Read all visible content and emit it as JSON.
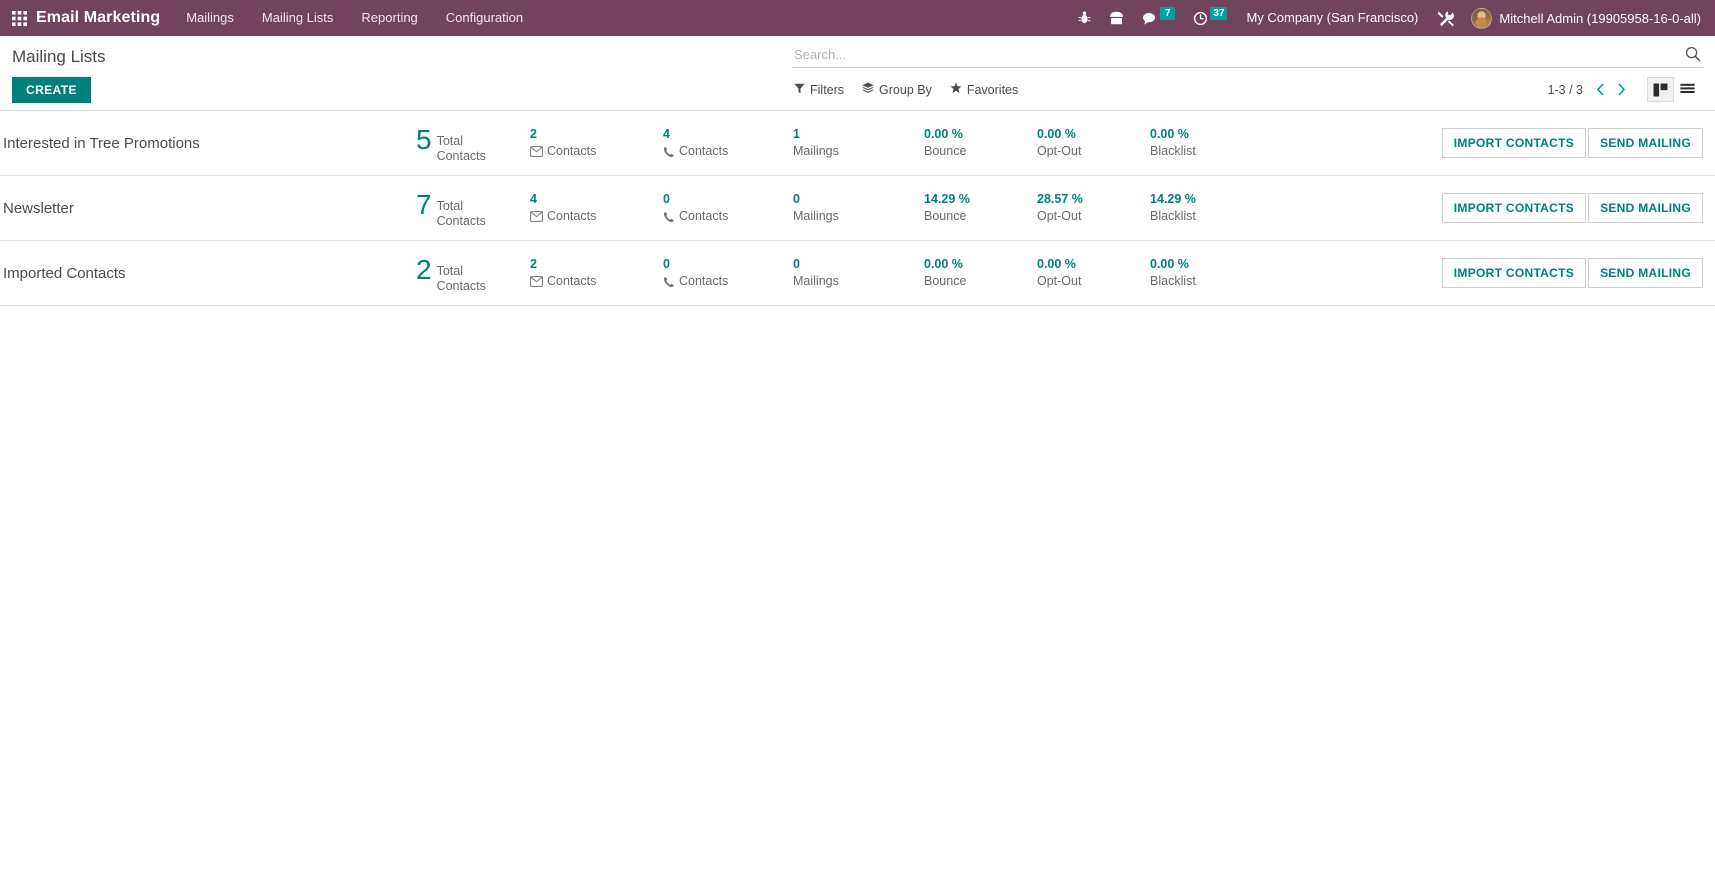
{
  "navbar": {
    "apps_icon": "apps-grid-icon",
    "brand": "Email Marketing",
    "menu": [
      {
        "label": "Mailings"
      },
      {
        "label": "Mailing Lists"
      },
      {
        "label": "Reporting"
      },
      {
        "label": "Configuration"
      }
    ],
    "sys_icons": [
      {
        "name": "bug-icon",
        "badge": ""
      },
      {
        "name": "phone-voip-icon",
        "badge": ""
      },
      {
        "name": "messages-icon",
        "badge": "7"
      },
      {
        "name": "activities-clock-icon",
        "badge": "37"
      }
    ],
    "company": "My Company (San Francisco)",
    "tools_icon": "wrench-tools-icon",
    "user": "Mitchell Admin (19905958-16-0-all)",
    "colors": {
      "navbar_bg": "#71435c",
      "badge_bg": "#00a09d"
    }
  },
  "control_panel": {
    "breadcrumb": "Mailing Lists",
    "create_label": "CREATE",
    "search": {
      "placeholder": "Search...",
      "value": ""
    },
    "tools": [
      {
        "label": "Filters",
        "icon": "filter-funnel-icon"
      },
      {
        "label": "Group By",
        "icon": "group-by-layers-icon"
      },
      {
        "label": "Favorites",
        "icon": "star-icon"
      }
    ],
    "pager": "1-3 / 3",
    "prev_icon": "chevron-left-icon",
    "next_icon": "chevron-right-icon",
    "views": [
      {
        "name": "kanban-view",
        "active": true
      },
      {
        "name": "list-view",
        "active": false
      }
    ],
    "accent": "#00807b"
  },
  "columns": {
    "total": "Total\nContacts",
    "total_l1": "Total",
    "total_l2": "Contacts",
    "mail_contacts": "Contacts",
    "phone_contacts": "Contacts",
    "mailings": "Mailings",
    "bounce": "Bounce",
    "optout": "Opt-Out",
    "blacklist": "Blacklist"
  },
  "actions": {
    "import_label": "IMPORT CONTACTS",
    "send_label": "SEND MAILING"
  },
  "rows": [
    {
      "title": "Interested in Tree Promotions",
      "total": "5",
      "mail_contacts": "2",
      "phone_contacts": "4",
      "mailings": "1",
      "bounce": "0.00 %",
      "optout": "0.00 %",
      "blacklist": "0.00 %"
    },
    {
      "title": "Newsletter",
      "total": "7",
      "mail_contacts": "4",
      "phone_contacts": "0",
      "mailings": "0",
      "bounce": "14.29 %",
      "optout": "28.57 %",
      "blacklist": "14.29 %"
    },
    {
      "title": "Imported Contacts",
      "total": "2",
      "mail_contacts": "2",
      "phone_contacts": "0",
      "mailings": "0",
      "bounce": "0.00 %",
      "optout": "0.00 %",
      "blacklist": "0.00 %"
    }
  ]
}
